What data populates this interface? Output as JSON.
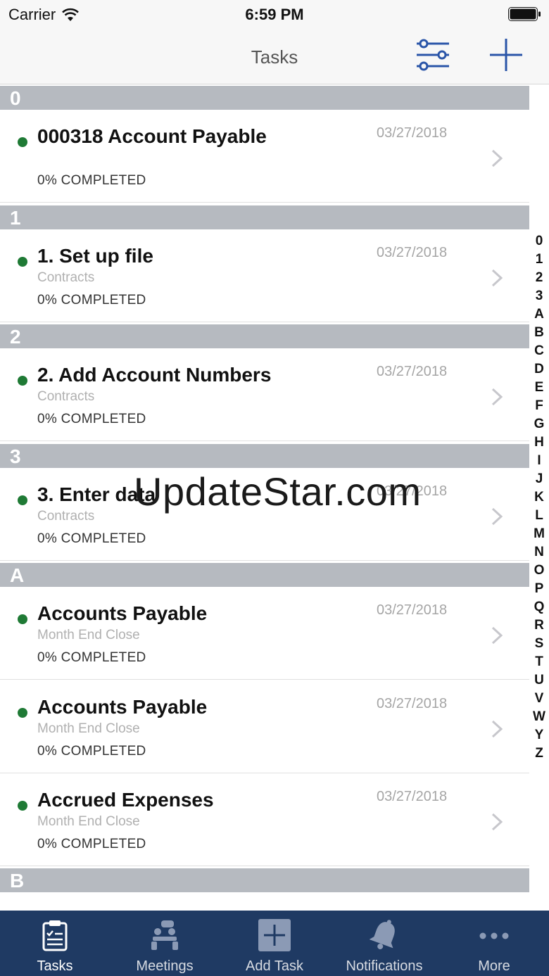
{
  "status_bar": {
    "carrier": "Carrier",
    "time": "6:59 PM"
  },
  "nav": {
    "title": "Tasks",
    "filter_icon": "sliders-icon",
    "add_icon": "plus-icon"
  },
  "sections": [
    {
      "header": "0",
      "rows": [
        {
          "title": "000318 Account Payable",
          "subtitle": "",
          "progress": "0% COMPLETED",
          "date": "03/27/2018"
        }
      ]
    },
    {
      "header": "1",
      "rows": [
        {
          "title": "1. Set up file",
          "subtitle": "Contracts",
          "progress": "0% COMPLETED",
          "date": "03/27/2018"
        }
      ]
    },
    {
      "header": "2",
      "rows": [
        {
          "title": "2. Add Account Numbers",
          "subtitle": "Contracts",
          "progress": "0% COMPLETED",
          "date": "03/27/2018"
        }
      ]
    },
    {
      "header": "3",
      "rows": [
        {
          "title": "3. Enter data",
          "subtitle": "Contracts",
          "progress": "0% COMPLETED",
          "date": "03/27/2018"
        }
      ]
    },
    {
      "header": "A",
      "rows": [
        {
          "title": "Accounts Payable",
          "subtitle": "Month End Close",
          "progress": "0% COMPLETED",
          "date": "03/27/2018"
        },
        {
          "title": "Accounts Payable",
          "subtitle": "Month End Close",
          "progress": "0% COMPLETED",
          "date": "03/27/2018"
        },
        {
          "title": "Accrued Expenses",
          "subtitle": "Month End Close",
          "progress": "0% COMPLETED",
          "date": "03/27/2018"
        }
      ]
    },
    {
      "header": "B",
      "rows": []
    }
  ],
  "status_color": "#1f7a35",
  "index": [
    "0",
    "1",
    "2",
    "3",
    "A",
    "B",
    "C",
    "D",
    "E",
    "F",
    "G",
    "H",
    "I",
    "J",
    "K",
    "L",
    "M",
    "N",
    "O",
    "P",
    "Q",
    "R",
    "S",
    "T",
    "U",
    "V",
    "W",
    "Y",
    "Z"
  ],
  "watermark": "UpdateStar.com",
  "tabs": [
    {
      "label": "Tasks",
      "icon": "clipboard-icon",
      "active": true
    },
    {
      "label": "Meetings",
      "icon": "meeting-icon",
      "active": false
    },
    {
      "label": "Add Task",
      "icon": "add-square-icon",
      "active": false
    },
    {
      "label": "Notifications",
      "icon": "bell-icon",
      "active": false
    },
    {
      "label": "More",
      "icon": "more-dots-icon",
      "active": false
    }
  ]
}
